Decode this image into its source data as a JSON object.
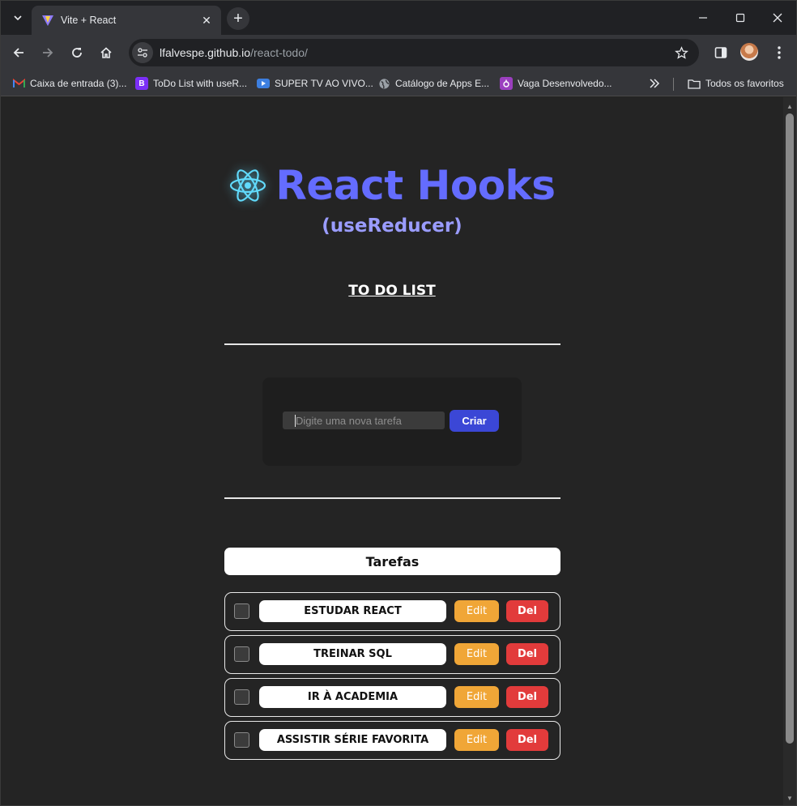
{
  "browser": {
    "tab": {
      "title": "Vite + React"
    },
    "address": {
      "host": "lfalvespe.github.io",
      "path": "/react-todo/"
    },
    "bookmarks": [
      {
        "label": "Caixa de entrada (3)...",
        "icon": "gmail-icon"
      },
      {
        "label": "ToDo List with useR...",
        "icon": "bootstrap-icon"
      },
      {
        "label": "SUPER TV AO VIVO...",
        "icon": "youtube-icon"
      },
      {
        "label": "Catálogo de Apps E...",
        "icon": "globe-icon"
      },
      {
        "label": "Vaga Desenvolvedo...",
        "icon": "instagram-icon"
      }
    ],
    "all_bookmarks": "Todos os favoritos"
  },
  "page": {
    "title": "React Hooks",
    "subtitle": "(useReducer)",
    "heading": "TO DO LIST",
    "form": {
      "placeholder": "Digite uma nova tarefa",
      "button": "Criar"
    },
    "list_header": "Tarefas",
    "tasks": [
      {
        "label": "ESTUDAR REACT",
        "edit": "Edit",
        "delete": "Del"
      },
      {
        "label": "TREINAR SQL",
        "edit": "Edit",
        "delete": "Del"
      },
      {
        "label": "IR À ACADEMIA",
        "edit": "Edit",
        "delete": "Del"
      },
      {
        "label": "ASSISTIR SÉRIE FAVORITA",
        "edit": "Edit",
        "delete": "Del"
      }
    ]
  },
  "colors": {
    "title": "#646cff",
    "subtitle": "#9a9cff",
    "create_button": "#3b47d6",
    "edit_button": "#f0a637",
    "delete_button": "#e23b3b"
  }
}
